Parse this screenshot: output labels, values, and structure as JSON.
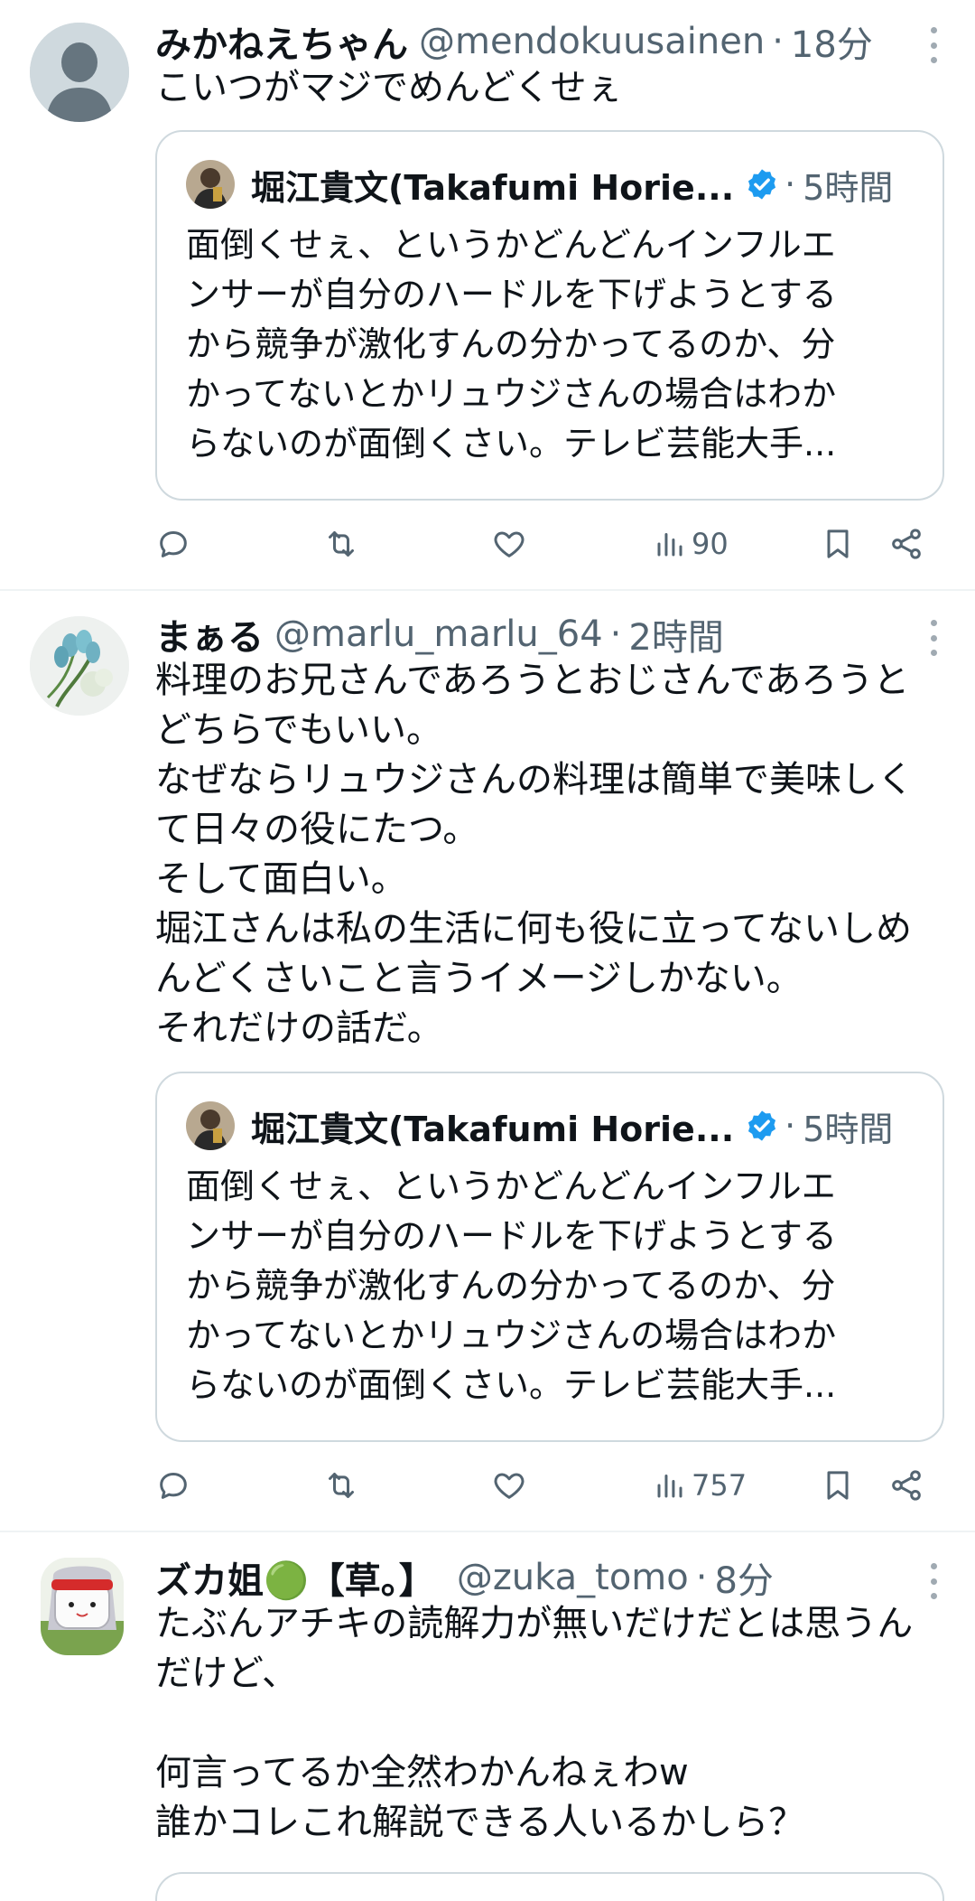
{
  "colors": {
    "accent": "#1d9bf0",
    "muted": "#536471",
    "border": "#cfd9de",
    "divider": "#eff3f4",
    "text": "#0f1419"
  },
  "tweets": [
    {
      "name": "みかねえちゃん",
      "handle": "@mendokuusainen",
      "dot": "·",
      "time": "18分",
      "text": "こいつがマジでめんどくせぇ",
      "quote": {
        "name": "堀江貴文(Takafumi Horie...",
        "dot": "·",
        "time": "5時間",
        "text": "面倒くせぇ、というかどんどんインフルエ\nンサーが自分のハードルを下げようとする\nから競争が激化すんの分かってるのか、分\nかってないとかリュウジさんの場合はわか\nらないのが面倒くさい。テレビ芸能大手..."
      },
      "views": "90"
    },
    {
      "name": "まぁる",
      "handle": "@marlu_marlu_64",
      "dot": "·",
      "time": "2時間",
      "text": "料理のお兄さんであろうとおじさんであろうと\nどちらでもいい。\nなぜならリュウジさんの料理は簡単で美味しく\nて日々の役にたつ。\nそして面白い。\n堀江さんは私の生活に何も役に立ってないしめ\nんどくさいこと言うイメージしかない。\nそれだけの話だ。",
      "quote": {
        "name": "堀江貴文(Takafumi Horie...",
        "dot": "·",
        "time": "5時間",
        "text": "面倒くせぇ、というかどんどんインフルエ\nンサーが自分のハードルを下げようとする\nから競争が激化すんの分かってるのか、分\nかってないとかリュウジさんの場合はわか\nらないのが面倒くさい。テレビ芸能大手..."
      },
      "views": "757"
    },
    {
      "name": "ズカ姐🟢【草。】",
      "handle": "@zuka_tomo",
      "dot": "·",
      "time": "8分",
      "text": "たぶんアチキの読解力が無いだけだとは思うん\nだけど、\n\n何言ってるか全然わかんねぇわw\n誰かコレこれ解説できる人いるかしら？"
    }
  ]
}
